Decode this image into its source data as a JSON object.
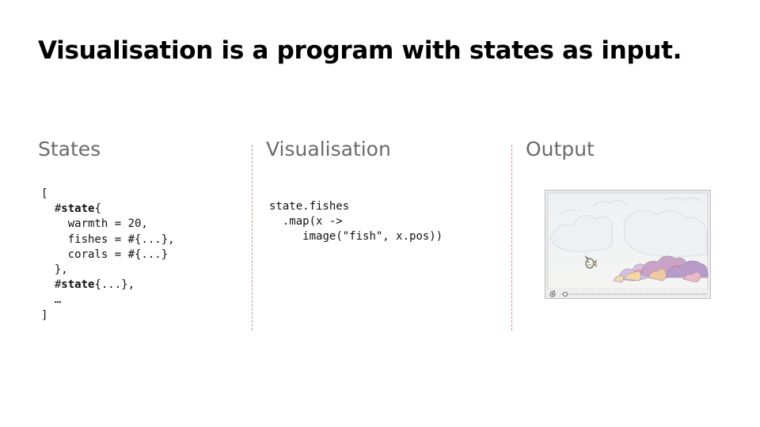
{
  "title": "Visualisation is a program with states as input.",
  "columns": {
    "states": {
      "heading": "States",
      "code": {
        "open_bracket": "[",
        "state_hash": "#",
        "state_kw": "state",
        "state_open": "{",
        "warmth_line": "warmth = 20,",
        "fishes_line": "fishes = #{...},",
        "corals_line": "corals = #{...}",
        "state_close": "},",
        "state2_hash": "#",
        "state2_kw": "state",
        "state2_rest": "{...},",
        "ellipsis": "…",
        "close_bracket": "]"
      }
    },
    "visualisation": {
      "heading": "Visualisation",
      "code": {
        "line1": "state.fishes",
        "line2": ".map(x ->",
        "line3": "image(\"fish\", x.pos))"
      }
    },
    "output": {
      "heading": "Output"
    }
  },
  "colors": {
    "divider": "#d28a8a",
    "heading": "#6b6b6b",
    "title": "#000000"
  }
}
